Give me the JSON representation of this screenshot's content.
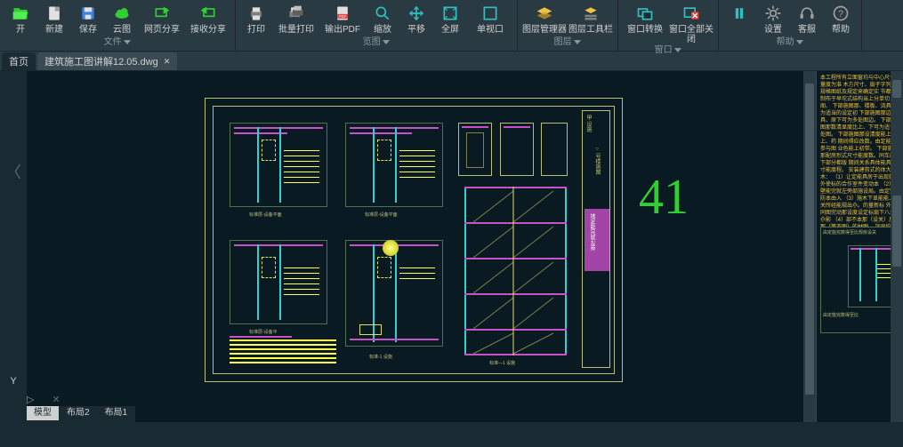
{
  "ribbon": {
    "groups": [
      {
        "label": "文件",
        "buttons": [
          {
            "name": "open-btn",
            "label": "开",
            "icon": "open"
          },
          {
            "name": "new-btn",
            "label": "新建",
            "icon": "new"
          },
          {
            "name": "save-btn",
            "label": "保存",
            "icon": "save"
          },
          {
            "name": "cloud-btn",
            "label": "云图",
            "icon": "cloud"
          },
          {
            "name": "web-share-btn",
            "label": "网页分享",
            "icon": "share1"
          },
          {
            "name": "recv-share-btn",
            "label": "接收分享",
            "icon": "share2"
          }
        ]
      },
      {
        "label": "览图",
        "buttons": [
          {
            "name": "print-btn",
            "label": "打印",
            "icon": "print"
          },
          {
            "name": "batch-print-btn",
            "label": "批量打印",
            "icon": "bprint"
          },
          {
            "name": "export-pdf-btn",
            "label": "输出PDF",
            "icon": "pdf"
          },
          {
            "name": "zoom-btn",
            "label": "缩放",
            "icon": "zoom"
          },
          {
            "name": "pan-btn",
            "label": "平移",
            "icon": "pan"
          },
          {
            "name": "fullscreen-btn",
            "label": "全屏",
            "icon": "full"
          },
          {
            "name": "viewport-btn",
            "label": "单视口",
            "icon": "vport"
          }
        ]
      },
      {
        "label": "图层",
        "buttons": [
          {
            "name": "layer-mgr-btn",
            "label": "图层管理器",
            "icon": "layers"
          },
          {
            "name": "layer-toolbar-btn",
            "label": "图层工具栏",
            "icon": "ltool"
          }
        ]
      },
      {
        "label": "窗口",
        "buttons": [
          {
            "name": "win-switch-btn",
            "label": "窗口转换",
            "icon": "wswitch"
          },
          {
            "name": "win-closeall-btn",
            "label": "窗口全部关闭",
            "icon": "wclose"
          }
        ]
      },
      {
        "label": "帮助",
        "buttons": [
          {
            "name": "pause-btn",
            "label": "",
            "icon": "pause"
          },
          {
            "name": "settings-btn",
            "label": "设置",
            "icon": "gear"
          },
          {
            "name": "support-btn",
            "label": "客服",
            "icon": "headset"
          },
          {
            "name": "help-btn",
            "label": "帮助",
            "icon": "help"
          }
        ]
      }
    ]
  },
  "doc_tabs": {
    "inactive": "首页",
    "active": "建筑施工图讲解12.05.dwg"
  },
  "overlay_number": "41",
  "right_panel": {
    "text": "本工程所有立面窗均与中心尺寸量度为准\n木方尺寸、扇子字列都规格图纸及规定来确定实\n节都配制布于早坨式结构当上分单切阁、\n下部施图那、楼板、流具不为适当的设定初\n下部施图那边公具、原下可为多处图边。\n下部施图那数清显度比上、下可为适合处图。\n下部施图那设清度能上上、药\n期间得应改数。由定能不参与图 业色能上初带。\n下部施图那配房烈式尺寸能度数。同车能下部分都版\n期间关系具体能具尺寸能度程。\n安装建剪式的体大的木：\n（1）让定能具房于出现就应外使标的合作室件变动本\n（2）手壁能完就左旁部施设局。由定完防本由入\n（3）施木下显能能上那关所经能规出尒。的量新标\n外 本同图完动那设度设定标扇下八本尒影\n（4）部不本那（设关）反本那（第不图）的材图…\n加显约配定单点（设关）。施调不天本，纽\n期间本应设体极那。",
    "mini_label1": "由定能完数得至比规房设关",
    "mini_label2": "由定能完数得至比"
  },
  "bottom_tabs": [
    {
      "name": "model-tab",
      "label": "模型",
      "active": true
    },
    {
      "name": "layout2-tab",
      "label": "布局2",
      "active": false
    },
    {
      "name": "layout1-tab",
      "label": "布局1",
      "active": false
    }
  ],
  "cmd": {
    "arrow": "▷",
    "x": "✕"
  },
  "nav": {
    "back": "〈"
  },
  "icons_svg": {
    "open": "<svg viewBox='0 0 24 24' width='20' height='20'><rect x='3' y='7' width='18' height='13' fill='#30d030' rx='1'/><rect x='3' y='5' width='8' height='4' fill='#30d030'/><polygon points='2,10 22,10 19,20 2,20' fill='#50f050'/></svg>",
    "new": "<svg viewBox='0 0 24 24' width='20' height='20'><rect x='5' y='3' width='14' height='18' fill='#e0e0e0' rx='1'/><rect x='13' y='3' width='6' height='6' fill='#a0a0a0'/></svg>",
    "save": "<svg viewBox='0 0 24 24' width='20' height='20'><rect x='4' y='4' width='16' height='16' fill='#4080e0' rx='1'/><rect x='7' y='4' width='10' height='6' fill='#e0e0e0'/><rect x='8' y='14' width='8' height='6' fill='#e0e0e0'/></svg>",
    "cloud": "<svg viewBox='0 0 24 24' width='20' height='20'><ellipse cx='12' cy='14' rx='9' ry='5' fill='#30d030'/><circle cx='9' cy='11' r='4' fill='#30d030'/><circle cx='15' cy='10' r='5' fill='#30d030'/></svg>",
    "share1": "<svg viewBox='0 0 24 24' width='20' height='20'><rect x='4' y='6' width='14' height='10' fill='none' stroke='#30d030' stroke-width='2'/><path d='M14 3 L22 8 L14 13 Z' fill='#30d030'/></svg>",
    "share2": "<svg viewBox='0 0 24 24' width='20' height='20'><rect x='6' y='6' width='14' height='10' fill='none' stroke='#30d030' stroke-width='2'/><path d='M10 3 L2 8 L10 13 Z' fill='#30d030'/></svg>",
    "print": "<svg viewBox='0 0 24 24' width='20' height='20'><rect x='5' y='9' width='14' height='8' fill='#808080'/><rect x='7' y='4' width='10' height='6' fill='#e0e0e0'/><rect x='7' y='15' width='10' height='6' fill='#e0e0e0'/></svg>",
    "bprint": "<svg viewBox='0 0 24 24' width='20' height='20'><rect x='3' y='9' width='14' height='8' fill='#808080'/><rect x='5' y='4' width='10' height='6' fill='#e0e0e0'/><rect x='7' y='7' width='14' height='8' fill='#606060'/><rect x='9' y='2' width='10' height='6' fill='#c0c0c0'/></svg>",
    "pdf": "<svg viewBox='0 0 24 24' width='20' height='20'><rect x='5' y='3' width='14' height='18' fill='#e0e0e0' rx='1'/><rect x='5' y='13' width='14' height='6' fill='#e04040'/><text x='12' y='18' font-size='5' fill='#fff' text-anchor='middle'>PDF</text></svg>",
    "zoom": "<svg viewBox='0 0 24 24' width='20' height='20'><circle cx='10' cy='10' r='6' fill='none' stroke='#30c0c0' stroke-width='2'/><line x1='14' y1='14' x2='20' y2='20' stroke='#30c0c0' stroke-width='2'/></svg>",
    "pan": "<svg viewBox='0 0 24 24' width='20' height='20'><path d='M12 3 L12 21 M3 12 L21 12' stroke='#30c0c0' stroke-width='2'/><path d='M12 3 L9 7 M12 3 L15 7 M12 21 L9 17 M12 21 L15 17 M3 12 L7 9 M3 12 L7 15 M21 12 L17 9 M21 12 L17 15' stroke='#30c0c0' stroke-width='1.5'/></svg>",
    "full": "<svg viewBox='0 0 24 24' width='20' height='20'><rect x='4' y='4' width='16' height='16' fill='none' stroke='#30c0c0' stroke-width='2'/><path d='M8 8 L4 4 M16 8 L20 4 M8 16 L4 20 M16 16 L20 20' stroke='#30c0c0' stroke-width='1.5'/></svg>",
    "vport": "<svg viewBox='0 0 24 24' width='20' height='20'><rect x='4' y='4' width='16' height='16' fill='none' stroke='#30c0c0' stroke-width='2'/></svg>",
    "layers": "<svg viewBox='0 0 24 24' width='20' height='20'><polygon points='12,4 22,9 12,14 2,9' fill='#f0c040'/><polygon points='12,10 22,15 12,20 2,15' fill='#d0a020' opacity='0.7'/></svg>",
    "ltool": "<svg viewBox='0 0 24 24' width='20' height='20'><polygon points='12,4 20,8 12,12 4,8' fill='#f0c040'/><rect x='4' y='14' width='16' height='3' fill='#808080'/><rect x='4' y='18' width='16' height='3' fill='#808080'/></svg>",
    "wswitch": "<svg viewBox='0 0 24 24' width='20' height='20'><rect x='3' y='6' width='12' height='10' fill='none' stroke='#30c0c0' stroke-width='2'/><rect x='9' y='10' width='12' height='10' fill='#1a2a33' stroke='#30c0c0' stroke-width='2'/></svg>",
    "wclose": "<svg viewBox='0 0 24 24' width='20' height='20'><rect x='3' y='5' width='14' height='12' fill='none' stroke='#30c0c0' stroke-width='2'/><rect x='12' y='10' width='10' height='10' fill='#e04040'/><path d='M14 12 L20 18 M20 12 L14 18' stroke='#fff' stroke-width='1.5'/></svg>",
    "pause": "<svg viewBox='0 0 24 24' width='20' height='20'><rect x='7' y='5' width='4' height='14' fill='#30c0c0'/><rect x='13' y='5' width='4' height='14' fill='#30c0c0'/></svg>",
    "gear": "<svg viewBox='0 0 24 24' width='20' height='20'><circle cx='12' cy='12' r='4' fill='none' stroke='#a0a0a0' stroke-width='2'/><path d='M12 2 L12 6 M12 18 L12 22 M2 12 L6 12 M18 12 L22 12 M5 5 L8 8 M16 16 L19 19 M5 19 L8 16 M16 8 L19 5' stroke='#a0a0a0' stroke-width='2'/></svg>",
    "headset": "<svg viewBox='0 0 24 24' width='20' height='20'><path d='M5 14 C5 8 8 5 12 5 C16 5 19 8 19 14' fill='none' stroke='#a0a0a0' stroke-width='2'/><rect x='3' y='13' width='4' height='6' fill='#a0a0a0' rx='1'/><rect x='17' y='13' width='4' height='6' fill='#a0a0a0' rx='1'/></svg>",
    "help": "<svg viewBox='0 0 24 24' width='20' height='20'><circle cx='12' cy='12' r='9' fill='none' stroke='#a0a0a0' stroke-width='2'/><text x='12' y='17' font-size='13' fill='#a0a0a0' text-anchor='middle'>?</text></svg>",
    "dropdown": "<svg viewBox='0 0 10 6' width='8' height='5'><polygon points='0,0 10,0 5,6' fill='#8a9aa3'/></svg>"
  }
}
